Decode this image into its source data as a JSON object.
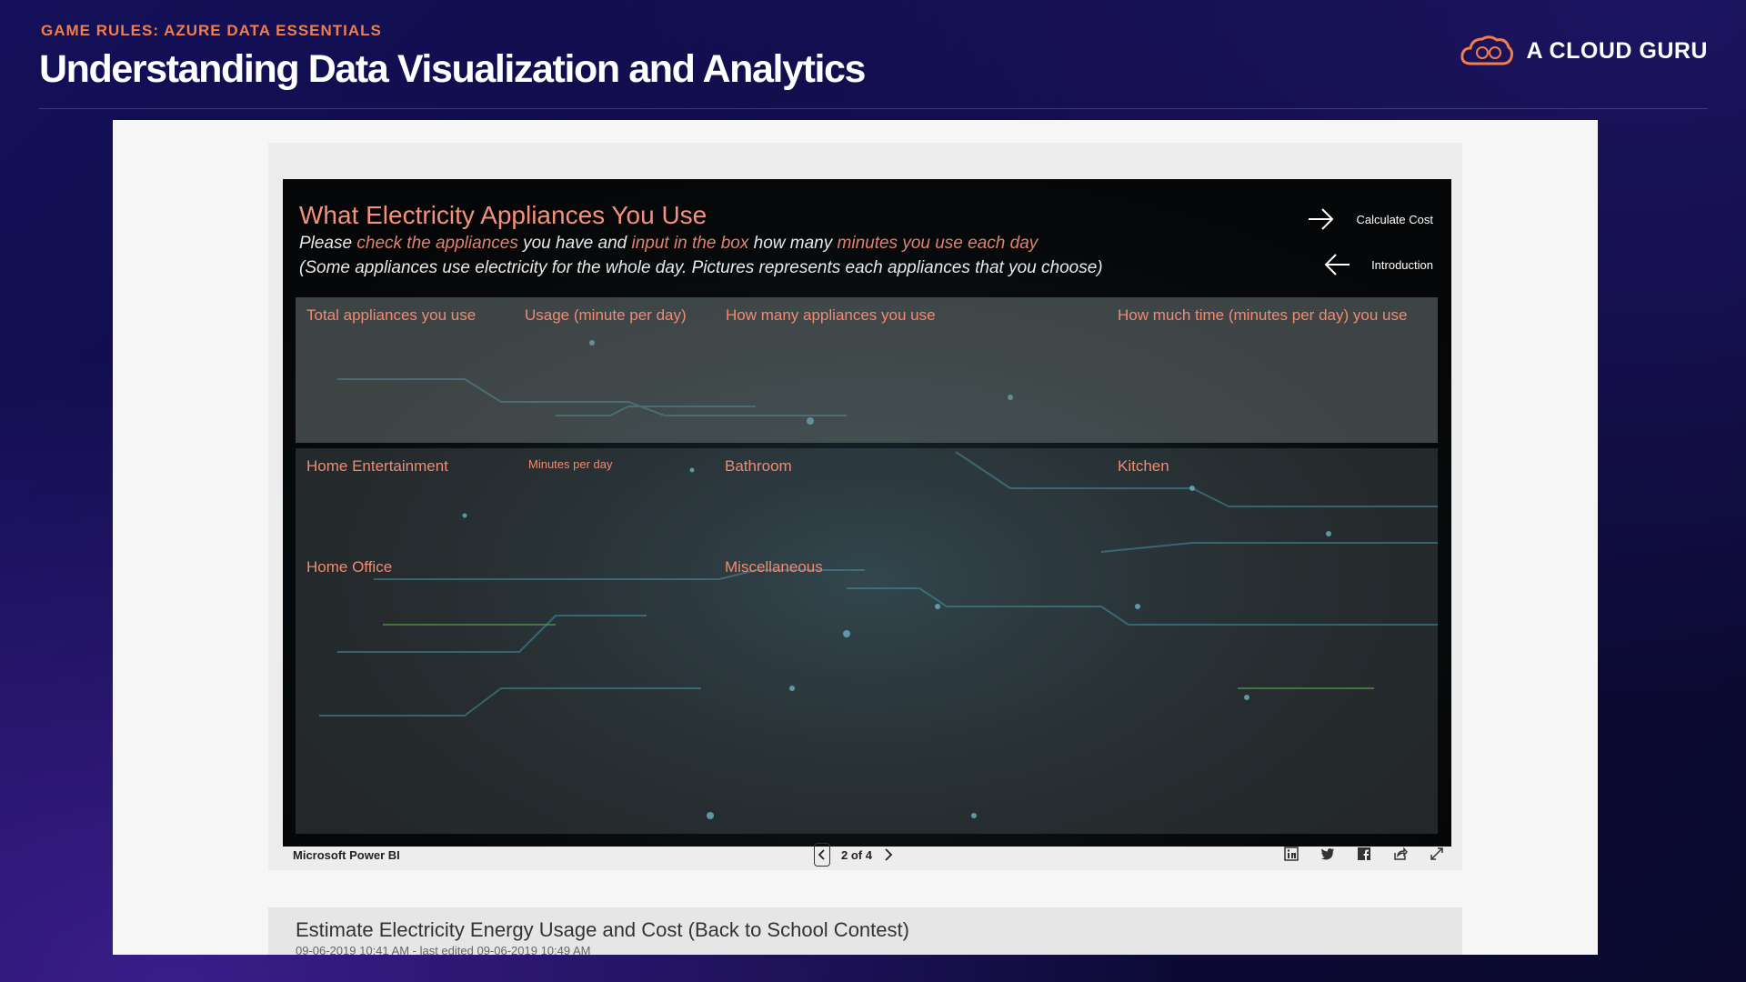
{
  "slide": {
    "kicker": "GAME RULES: AZURE DATA ESSENTIALS",
    "headline": "Understanding Data Visualization and Analytics",
    "brand": "A CLOUD GURU"
  },
  "report": {
    "title": "What Electricity Appliances You Use",
    "line1": {
      "a": "Please ",
      "b": "check the appliances",
      "c": " you have and ",
      "d": "input in the box",
      "e": " how many ",
      "f": "minutes you use each day"
    },
    "line2": "(Some appliances use electricity for the whole day. Pictures represents each appliances that you choose)",
    "nav": {
      "calc": "Calculate Cost",
      "intro": "Introduction"
    },
    "top_labels": {
      "total": "Total appliances you use",
      "usage": "Usage (minute per day)",
      "how_many": "How many appliances you use",
      "how_much": "How much time (minutes per day) you use"
    },
    "categories": {
      "home_ent": "Home Entertainment",
      "minutes": "Minutes per day",
      "bathroom": "Bathroom",
      "kitchen": "Kitchen",
      "home_office": "Home Office",
      "misc": "Miscellaneous"
    }
  },
  "footer": {
    "brand": "Microsoft Power BI",
    "page": "2 of 4"
  },
  "card": {
    "title": "Estimate Electricity Energy Usage and Cost (Back to School Contest)",
    "meta": "09-06-2019 10:41 AM - last edited 09-06-2019 10:49 AM"
  },
  "colors": {
    "accent": "#f07d4a",
    "report_text": "#f08a70",
    "bg": "#0d0b3d"
  }
}
